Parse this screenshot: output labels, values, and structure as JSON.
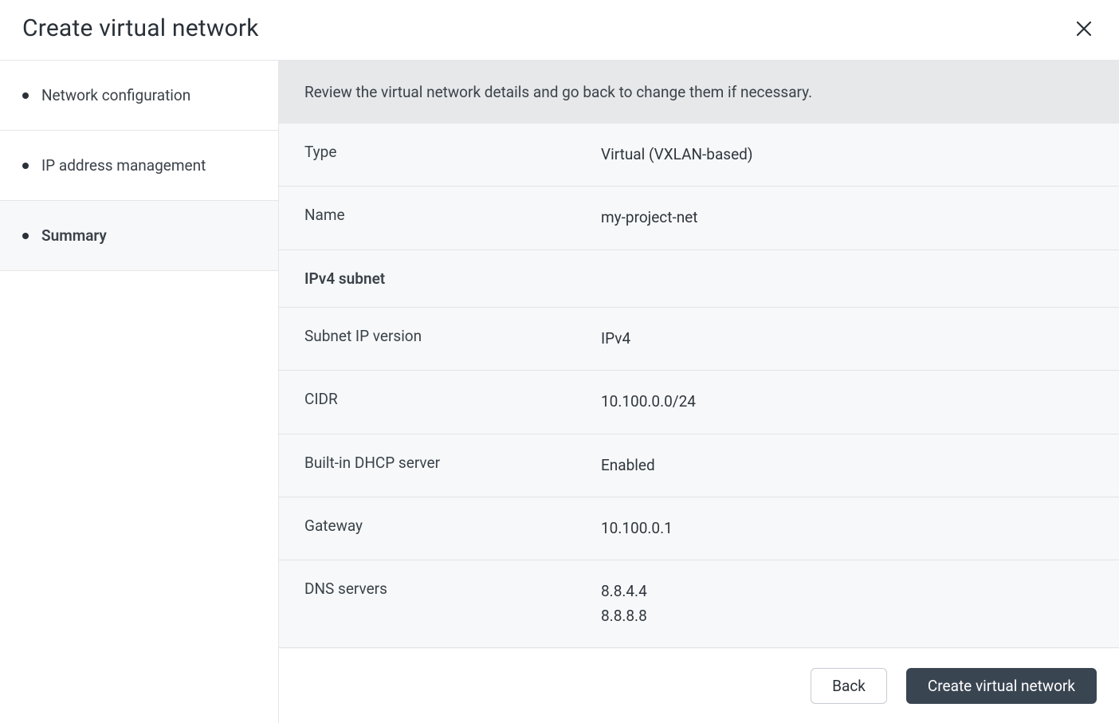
{
  "header": {
    "title": "Create virtual network"
  },
  "sidebar": {
    "items": [
      {
        "label": "Network configuration",
        "active": false
      },
      {
        "label": "IP address management",
        "active": false
      },
      {
        "label": "Summary",
        "active": true
      }
    ]
  },
  "description": "Review the virtual network details and go back to change them if necessary.",
  "summary": {
    "type_label": "Type",
    "type_value": "Virtual (VXLAN-based)",
    "name_label": "Name",
    "name_value": "my-project-net",
    "section_ipv4": "IPv4 subnet",
    "subnet_version_label": "Subnet IP version",
    "subnet_version_value": "IPv4",
    "cidr_label": "CIDR",
    "cidr_value": "10.100.0.0/24",
    "dhcp_label": "Built-in DHCP server",
    "dhcp_value": "Enabled",
    "gateway_label": "Gateway",
    "gateway_value": "10.100.0.1",
    "dns_label": "DNS servers",
    "dns_value_1": "8.8.4.4",
    "dns_value_2": "8.8.8.8"
  },
  "footer": {
    "back_label": "Back",
    "create_label": "Create virtual network"
  }
}
